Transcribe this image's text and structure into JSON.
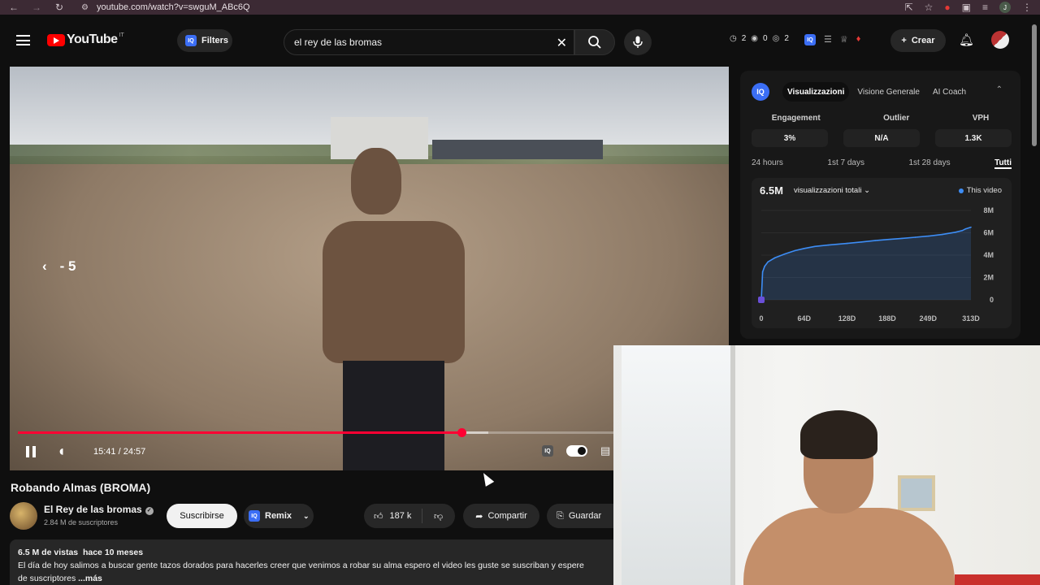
{
  "browser": {
    "url": "youtube.com/watch?v=swguM_ABc6Q",
    "profile_initial": "J"
  },
  "header": {
    "logo_text": "YouTube",
    "country_code": "IT",
    "filters_label": "Filters",
    "iq_badge": "IQ",
    "search_value": "el rey de las bromas",
    "stats": [
      "2",
      "0",
      "2"
    ],
    "create_label": "Crear"
  },
  "player": {
    "seek_hint": "- 5",
    "time_current": "15:41",
    "time_sep": " / ",
    "time_total": "24:57",
    "progress_fraction": 0.628,
    "buffer_fraction": 0.665
  },
  "video": {
    "title": "Robando Almas (BROMA)",
    "channel_name": "El Rey de las bromas",
    "verified_icon": "✓",
    "subscribers": "2.84 M de suscriptores",
    "subscribe_label": "Suscribirse",
    "remix_label": "Remix",
    "likes": "187 k",
    "share_label": "Compartir",
    "save_label": "Guardar",
    "views": "6.5 M de vistas",
    "age": "hace 10 meses",
    "description": "El día de hoy salimos a buscar gente tazos dorados para hacerles creer que venimos a robar su alma espero el video les guste se suscriban y espere",
    "description_line2": "de suscriptores",
    "more_label": "...más"
  },
  "iq_panel": {
    "logo": "IQ",
    "tabs": [
      "Visualizzazioni",
      "Visione Generale",
      "AI Coach"
    ],
    "active_tab": 0,
    "stats": [
      {
        "label": "Engagement",
        "value": "3%"
      },
      {
        "label": "Outlier",
        "value": "N/A"
      },
      {
        "label": "VPH",
        "value": "1.3K"
      }
    ],
    "ranges": [
      "24 hours",
      "1st 7 days",
      "1st 28 days",
      "Tutti"
    ],
    "active_range": 3,
    "total": "6.5M",
    "metric_label": "visualizzazioni totali",
    "legend": "This video",
    "series_color": "#3d8df5"
  },
  "chart_data": {
    "type": "area",
    "title": "",
    "xlabel": "",
    "ylabel": "",
    "x_ticks": [
      "0",
      "64D",
      "128D",
      "188D",
      "249D",
      "313D"
    ],
    "y_ticks": [
      "0",
      "2M",
      "4M",
      "6M",
      "8M"
    ],
    "ylim": [
      0,
      8000000
    ],
    "xlim": [
      0,
      313
    ],
    "series": [
      {
        "name": "This video",
        "x": [
          0,
          2,
          5,
          10,
          20,
          35,
          50,
          64,
          80,
          100,
          128,
          150,
          170,
          188,
          210,
          230,
          249,
          270,
          290,
          300,
          305,
          313
        ],
        "values": [
          0,
          2500000,
          3000000,
          3400000,
          3750000,
          4100000,
          4400000,
          4600000,
          4780000,
          4900000,
          5050000,
          5180000,
          5300000,
          5400000,
          5500000,
          5600000,
          5700000,
          5850000,
          6050000,
          6200000,
          6350000,
          6500000
        ]
      }
    ]
  }
}
